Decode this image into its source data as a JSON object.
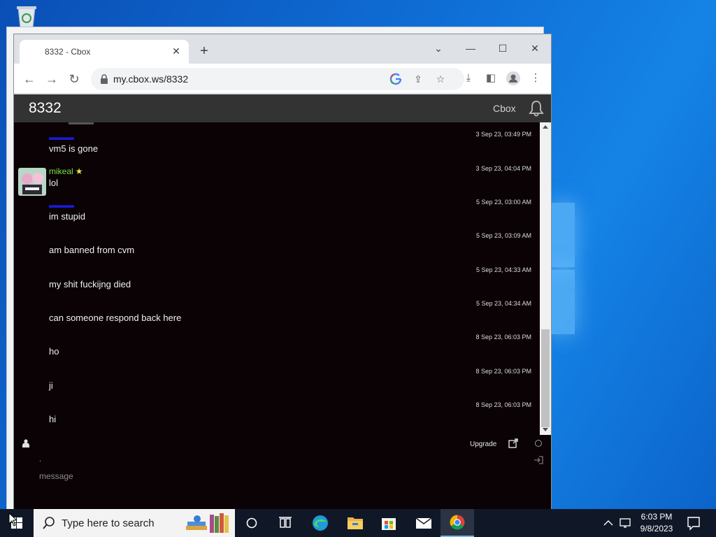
{
  "browser": {
    "tab_title": "8332 - Cbox",
    "url": "my.cbox.ws/8332"
  },
  "cbox": {
    "room_title": "8332",
    "header_link": "Cbox",
    "messages": [
      {
        "user": "",
        "text": "vm5 is gone",
        "time": "3 Sep 23, 03:49 PM"
      },
      {
        "user": "mikeal",
        "text": "lol",
        "time": "3 Sep 23, 04:04 PM"
      },
      {
        "user": "",
        "text": "im stupid",
        "time": "5 Sep 23, 03:00 AM"
      },
      {
        "user": "",
        "text": "am banned from cvm",
        "time": "5 Sep 23, 03:09 AM"
      },
      {
        "user": "",
        "text": "my shit fuckijng died",
        "time": "5 Sep 23, 04:33 AM"
      },
      {
        "user": "",
        "text": "can someone respond back here",
        "time": "5 Sep 23, 04:34 AM"
      },
      {
        "user": "",
        "text": "ho",
        "time": "8 Sep 23, 06:03 PM"
      },
      {
        "user": "",
        "text": "ji",
        "time": "8 Sep 23, 06:03 PM"
      },
      {
        "user": "",
        "text": "hi",
        "time": "8 Sep 23, 06:03 PM"
      }
    ],
    "footer": {
      "upgrade_label": "Upgrade",
      "name_value": ".",
      "message_placeholder": "message"
    }
  },
  "taskbar": {
    "search_placeholder": "Type here to search",
    "time": "6:03 PM",
    "date": "9/8/2023"
  },
  "colors": {
    "chat_bg": "#0a0204",
    "header_bg": "#333333",
    "username_blue": "#1a1ad8",
    "username_green": "#7ee04a"
  }
}
